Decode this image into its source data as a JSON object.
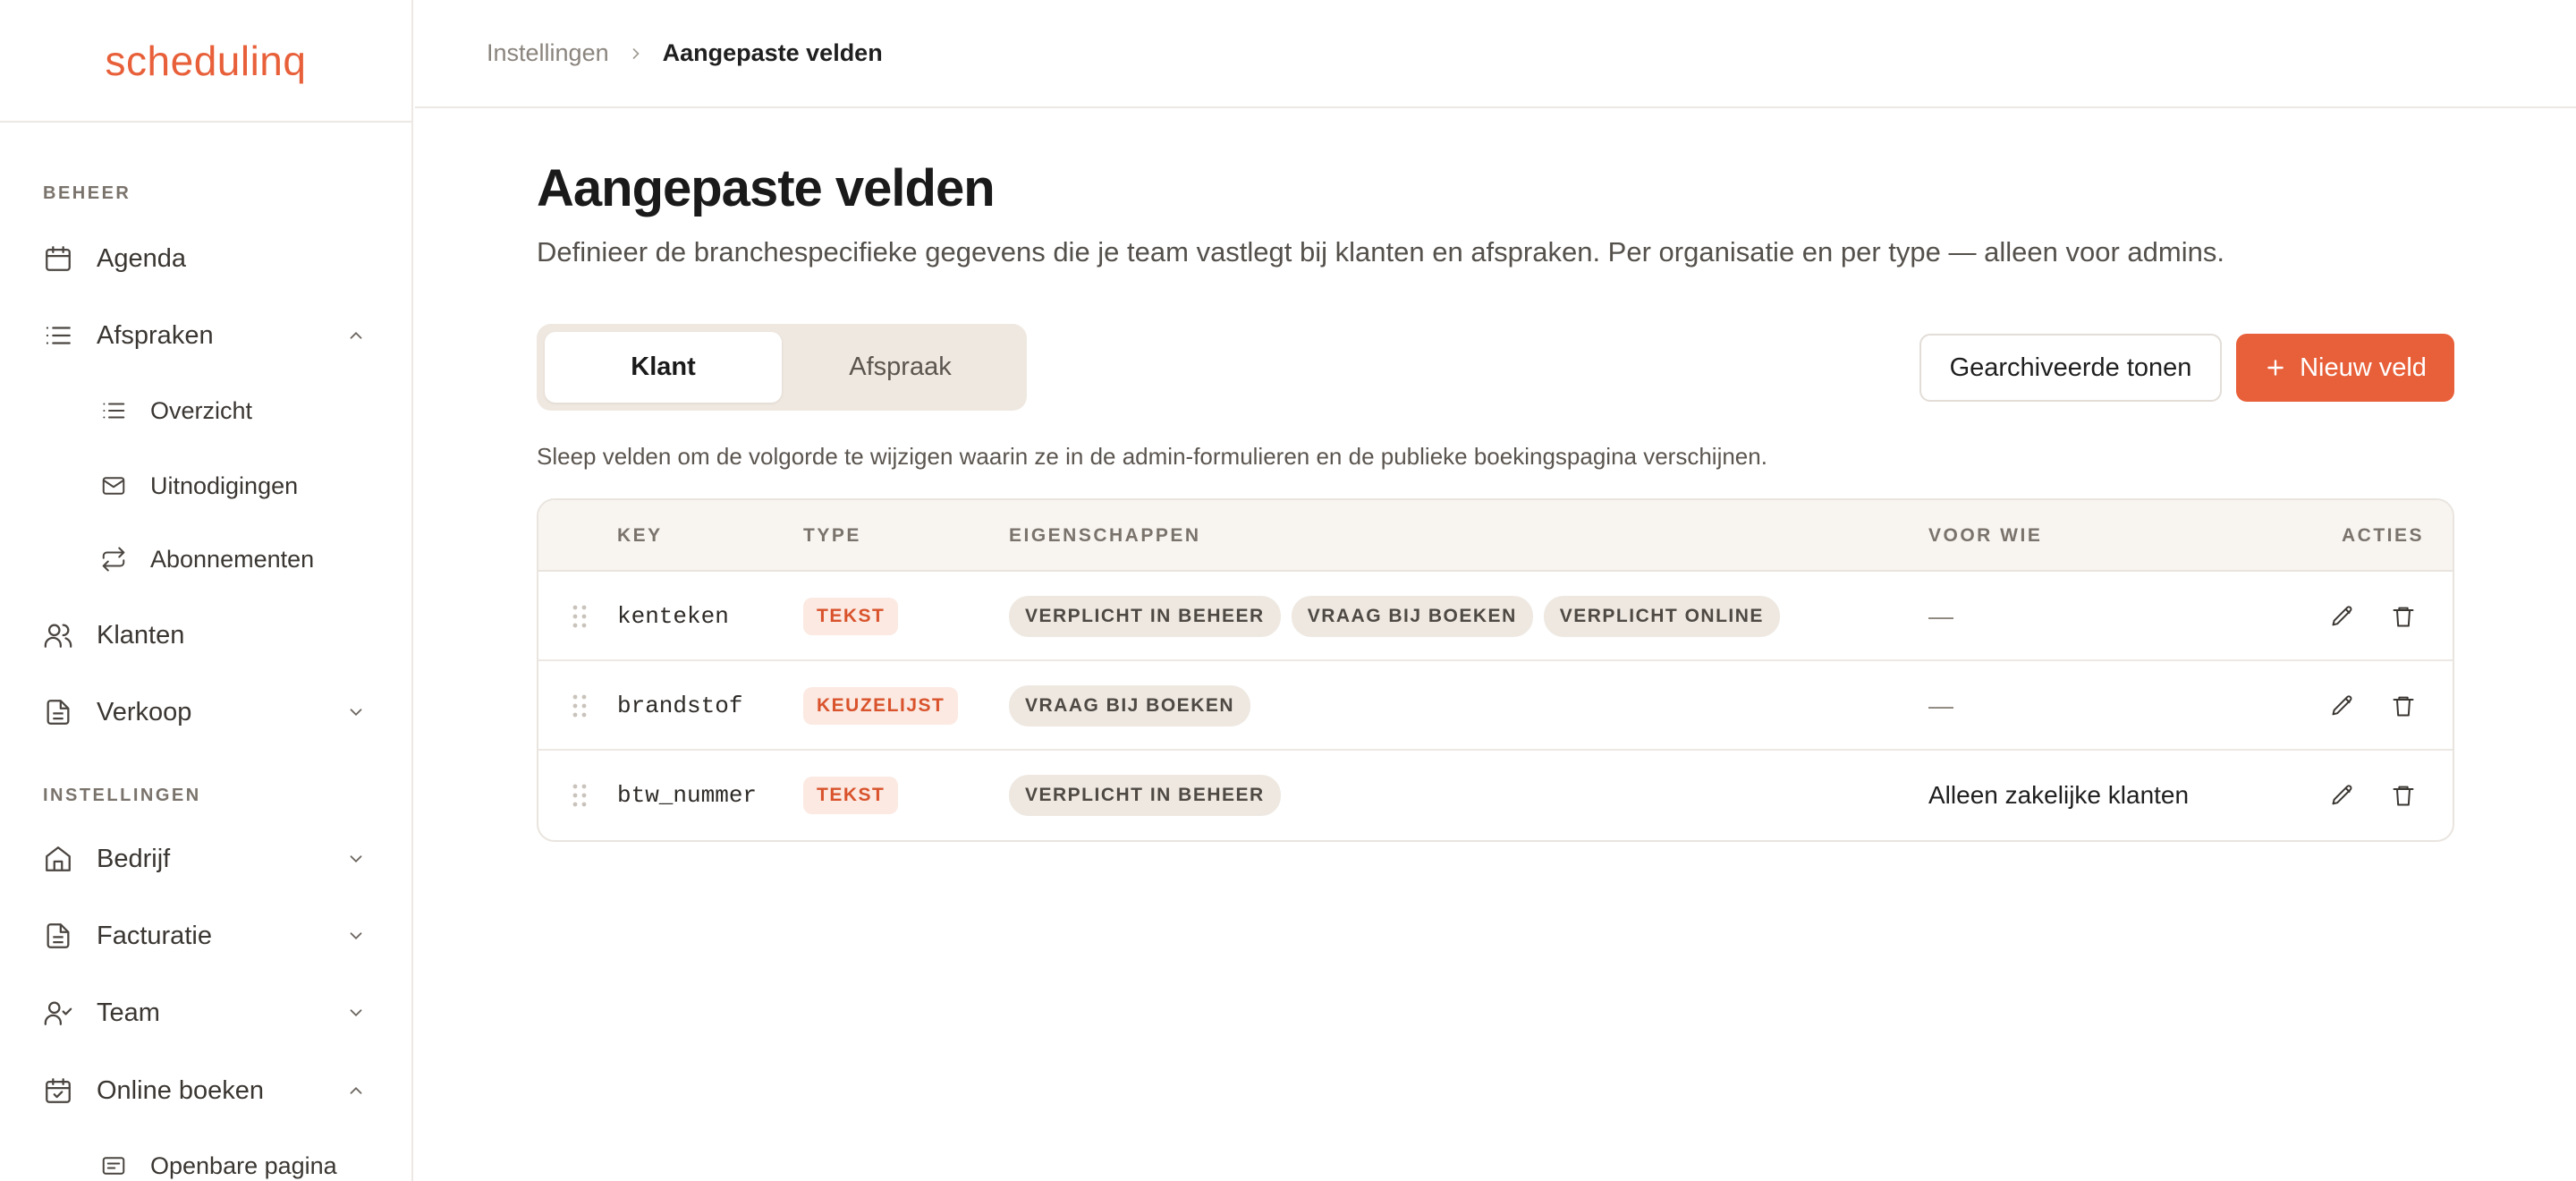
{
  "app": {
    "logo": "schedulinq"
  },
  "sidebar": {
    "section_beheer": "BEHEER",
    "section_instellingen": "INSTELLINGEN",
    "items": [
      {
        "label": "Agenda",
        "icon": "calendar-icon"
      },
      {
        "label": "Afspraken",
        "icon": "list-icon",
        "expanded": true
      },
      {
        "label": "Overzicht",
        "icon": "list-icon"
      },
      {
        "label": "Uitnodigingen",
        "icon": "mail-icon"
      },
      {
        "label": "Abonnementen",
        "icon": "repeat-icon"
      },
      {
        "label": "Klanten",
        "icon": "users-icon"
      },
      {
        "label": "Verkoop",
        "icon": "document-icon",
        "expanded": false
      },
      {
        "label": "Bedrijf",
        "icon": "home-icon",
        "expanded": false
      },
      {
        "label": "Facturatie",
        "icon": "document-icon",
        "expanded": false
      },
      {
        "label": "Team",
        "icon": "user-check-icon",
        "expanded": false
      },
      {
        "label": "Online boeken",
        "icon": "calendar-check-icon",
        "expanded": true
      },
      {
        "label": "Openbare pagina",
        "icon": "card-icon"
      }
    ]
  },
  "breadcrumb": {
    "parent": "Instellingen",
    "current": "Aangepaste velden"
  },
  "page": {
    "title": "Aangepaste velden",
    "description": "Definieer de branchespecifieke gegevens die je team vastlegt bij klanten en afspraken. Per organisatie en per type — alleen voor admins.",
    "tabs": [
      {
        "label": "Klant",
        "active": true
      },
      {
        "label": "Afspraak",
        "active": false
      }
    ],
    "show_archived_label": "Gearchiveerde tonen",
    "new_field_label": "Nieuw veld",
    "hint": "Sleep velden om de volgorde te wijzigen waarin ze in de admin-formulieren en de publieke boekingspagina verschijnen."
  },
  "table": {
    "headers": {
      "key": "KEY",
      "type": "TYPE",
      "props": "EIGENSCHAPPEN",
      "who": "VOOR WIE",
      "actions": "ACTIES"
    },
    "rows": [
      {
        "key": "kenteken",
        "type": "TEKST",
        "props": [
          "VERPLICHT IN BEHEER",
          "VRAAG BIJ BOEKEN",
          "VERPLICHT ONLINE"
        ],
        "who": "—"
      },
      {
        "key": "brandstof",
        "type": "KEUZELIJST",
        "props": [
          "VRAAG BIJ BOEKEN"
        ],
        "who": "—"
      },
      {
        "key": "btw_nummer",
        "type": "TEKST",
        "props": [
          "VERPLICHT IN BEHEER"
        ],
        "who": "Alleen zakelijke klanten"
      }
    ]
  },
  "colors": {
    "accent": "#e8603a",
    "badge_bg": "#fbe9e2",
    "chip_bg": "#eee8e1"
  }
}
